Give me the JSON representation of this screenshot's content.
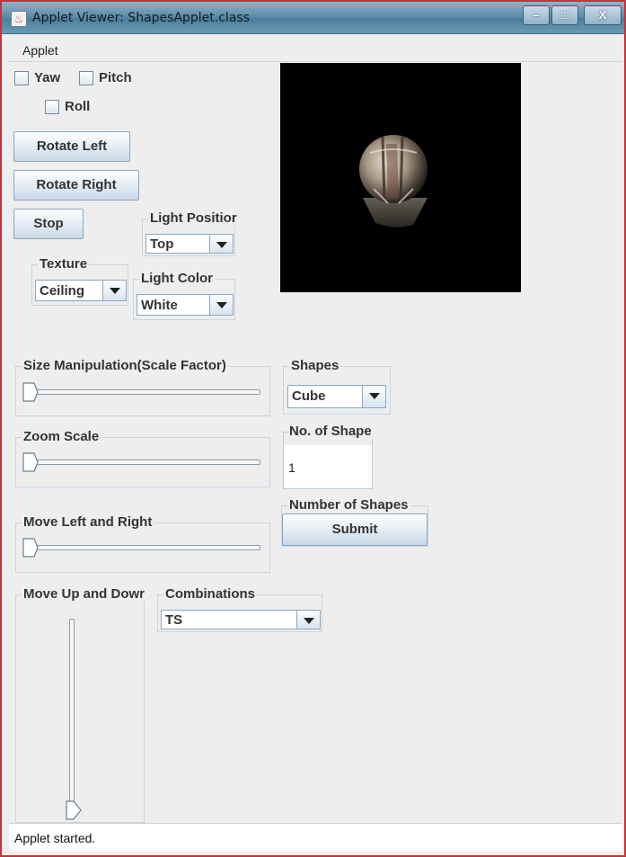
{
  "window": {
    "title": "Applet Viewer: ShapesApplet.class"
  },
  "menu": {
    "applet": "Applet"
  },
  "controls": {
    "yaw": "Yaw",
    "pitch": "Pitch",
    "roll": "Roll",
    "rotate_left": "Rotate Left",
    "rotate_right": "Rotate Right",
    "stop": "Stop",
    "light_position": {
      "label": "Light Positior",
      "value": "Top"
    },
    "texture": {
      "label": "Texture",
      "value": "Ceiling"
    },
    "light_color": {
      "label": "Light Color",
      "value": "White"
    },
    "size_manipulation": {
      "label": "Size Manipulation(Scale Factor)",
      "value": 0
    },
    "shapes": {
      "label": "Shapes",
      "value": "Cube"
    },
    "zoom_scale": {
      "label": "Zoom Scale",
      "value": 0
    },
    "no_of_shape": {
      "label": "No. of Shape",
      "value": "1"
    },
    "number_of_shapes": {
      "label": "Number of Shapes",
      "submit": "Submit"
    },
    "move_left_right": {
      "label": "Move Left and Right",
      "value": 0
    },
    "move_up_down": {
      "label": "Move Up and Dowr",
      "value": 0
    },
    "combinations": {
      "label": "Combinations",
      "value": "TS"
    }
  },
  "status": {
    "text": "Applet started."
  },
  "colors": {
    "titlebar": "#5f8ea9",
    "canvas": "#000000",
    "border": "#c8323a"
  },
  "icons": [
    "java-icon",
    "minimize-icon",
    "maximize-icon",
    "close-icon",
    "chevron-down-icon"
  ]
}
